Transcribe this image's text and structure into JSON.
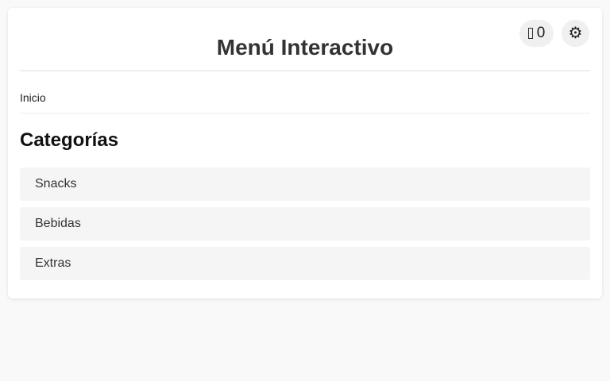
{
  "header": {
    "title": "Menú Interactivo",
    "cart_icon": "cart-icon",
    "cart_count": "0",
    "settings_icon": "gear-icon",
    "settings_glyph": "⚙"
  },
  "breadcrumb": {
    "items": [
      "Inicio"
    ]
  },
  "main": {
    "section_title": "Categorías",
    "categories": [
      {
        "label": "Snacks"
      },
      {
        "label": "Bebidas"
      },
      {
        "label": "Extras"
      }
    ]
  },
  "colors": {
    "background": "#f9f9f9",
    "card": "#ffffff",
    "item_background": "#f5f5f5",
    "pill_background": "#f0f0f0",
    "divider": "#eeeeee"
  }
}
